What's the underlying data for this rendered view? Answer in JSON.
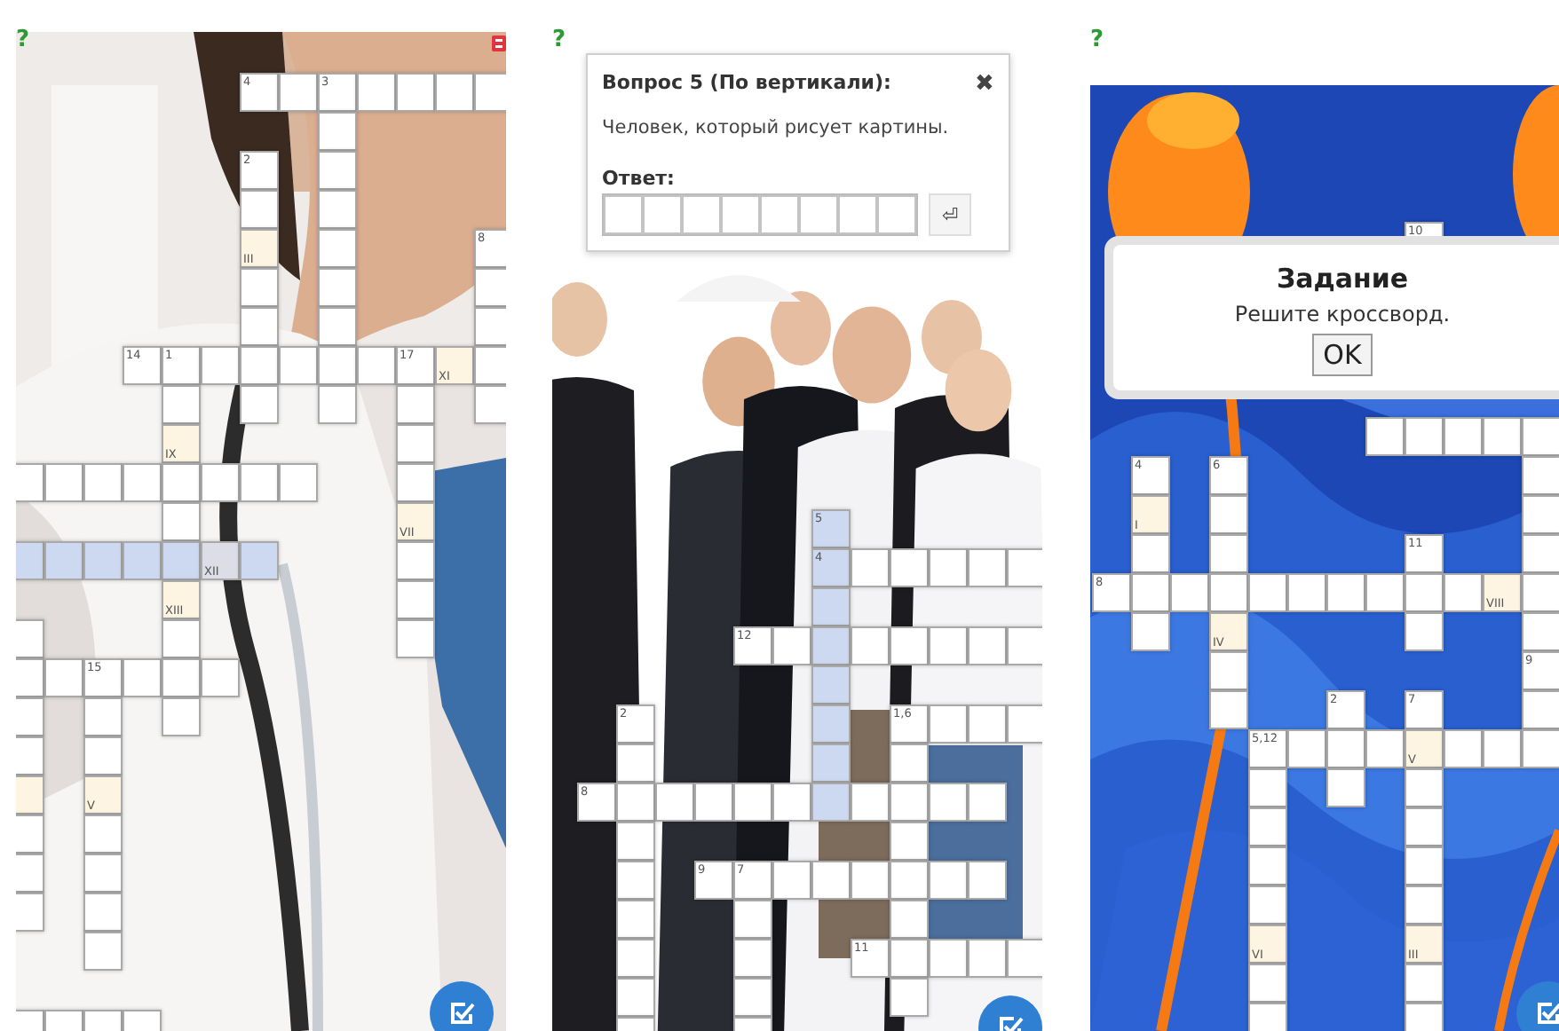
{
  "panels": [
    {
      "help_icon": "?",
      "grid": {
        "rows": [
          [
            {
              "kind": "gap"
            },
            {
              "kind": "gap"
            },
            {
              "kind": "gap"
            },
            {
              "kind": "gap"
            },
            {
              "kind": "gap"
            },
            {
              "kind": "gap"
            },
            {
              "kind": "box",
              "label": "4"
            },
            {
              "kind": "box"
            },
            {
              "kind": "box",
              "label": "3"
            },
            {
              "kind": "box"
            },
            {
              "kind": "box"
            },
            {
              "kind": "box"
            },
            {
              "kind": "box"
            }
          ],
          [
            {
              "kind": "gap"
            },
            {
              "kind": "gap"
            },
            {
              "kind": "gap"
            },
            {
              "kind": "gap"
            },
            {
              "kind": "gap"
            },
            {
              "kind": "gap"
            },
            {
              "kind": "gap"
            },
            {
              "kind": "gap"
            },
            {
              "kind": "box"
            }
          ],
          [
            {
              "kind": "gap"
            },
            {
              "kind": "gap"
            },
            {
              "kind": "gap"
            },
            {
              "kind": "gap"
            },
            {
              "kind": "gap"
            },
            {
              "kind": "gap"
            },
            {
              "kind": "box",
              "label": "2"
            },
            {
              "kind": "gap"
            },
            {
              "kind": "box"
            }
          ],
          [
            {
              "kind": "gap"
            },
            {
              "kind": "gap"
            },
            {
              "kind": "gap"
            },
            {
              "kind": "gap"
            },
            {
              "kind": "gap"
            },
            {
              "kind": "gap"
            },
            {
              "kind": "box"
            },
            {
              "kind": "gap"
            },
            {
              "kind": "box"
            }
          ],
          [
            {
              "kind": "gap"
            },
            {
              "kind": "gap"
            },
            {
              "kind": "gap"
            },
            {
              "kind": "gap"
            },
            {
              "kind": "gap"
            },
            {
              "kind": "gap"
            },
            {
              "kind": "key",
              "label": "III"
            },
            {
              "kind": "gap"
            },
            {
              "kind": "box"
            },
            {
              "kind": "gap"
            },
            {
              "kind": "gap"
            },
            {
              "kind": "gap"
            },
            {
              "kind": "box",
              "label": "8"
            }
          ],
          [
            {
              "kind": "gap"
            },
            {
              "kind": "gap"
            },
            {
              "kind": "gap"
            },
            {
              "kind": "gap"
            },
            {
              "kind": "gap"
            },
            {
              "kind": "gap"
            },
            {
              "kind": "box"
            },
            {
              "kind": "gap"
            },
            {
              "kind": "box"
            },
            {
              "kind": "gap"
            },
            {
              "kind": "gap"
            },
            {
              "kind": "gap"
            },
            {
              "kind": "box"
            }
          ],
          [
            {
              "kind": "gap"
            },
            {
              "kind": "gap"
            },
            {
              "kind": "gap"
            },
            {
              "kind": "gap"
            },
            {
              "kind": "gap"
            },
            {
              "kind": "gap"
            },
            {
              "kind": "box"
            },
            {
              "kind": "gap"
            },
            {
              "kind": "box"
            },
            {
              "kind": "gap"
            },
            {
              "kind": "gap"
            },
            {
              "kind": "gap"
            },
            {
              "kind": "box"
            }
          ],
          [
            {
              "kind": "gap"
            },
            {
              "kind": "gap"
            },
            {
              "kind": "gap"
            },
            {
              "kind": "box",
              "label": "14"
            },
            {
              "kind": "box",
              "label": "1"
            },
            {
              "kind": "box"
            },
            {
              "kind": "box"
            },
            {
              "kind": "box"
            },
            {
              "kind": "box"
            },
            {
              "kind": "box"
            },
            {
              "kind": "box",
              "label": "17"
            },
            {
              "kind": "key",
              "label": "XI"
            },
            {
              "kind": "box"
            }
          ],
          [
            {
              "kind": "gap"
            },
            {
              "kind": "gap"
            },
            {
              "kind": "gap"
            },
            {
              "kind": "gap"
            },
            {
              "kind": "box"
            },
            {
              "kind": "gap"
            },
            {
              "kind": "box"
            },
            {
              "kind": "gap"
            },
            {
              "kind": "box"
            },
            {
              "kind": "gap"
            },
            {
              "kind": "box"
            },
            {
              "kind": "gap"
            },
            {
              "kind": "box"
            }
          ],
          [
            {
              "kind": "gap"
            },
            {
              "kind": "gap"
            },
            {
              "kind": "gap"
            },
            {
              "kind": "gap"
            },
            {
              "kind": "key",
              "label": "IX"
            },
            {
              "kind": "gap"
            },
            {
              "kind": "gap"
            },
            {
              "kind": "gap"
            },
            {
              "kind": "gap"
            },
            {
              "kind": "gap"
            },
            {
              "kind": "box"
            }
          ],
          [
            {
              "kind": "box"
            },
            {
              "kind": "box"
            },
            {
              "kind": "box"
            },
            {
              "kind": "box"
            },
            {
              "kind": "box"
            },
            {
              "kind": "box"
            },
            {
              "kind": "box"
            },
            {
              "kind": "box"
            },
            {
              "kind": "gap"
            },
            {
              "kind": "gap"
            },
            {
              "kind": "box"
            }
          ],
          [
            {
              "kind": "gap"
            },
            {
              "kind": "gap"
            },
            {
              "kind": "gap"
            },
            {
              "kind": "gap"
            },
            {
              "kind": "box"
            },
            {
              "kind": "gap"
            },
            {
              "kind": "gap"
            },
            {
              "kind": "gap"
            },
            {
              "kind": "gap"
            },
            {
              "kind": "gap"
            },
            {
              "kind": "key",
              "label": "VII"
            }
          ],
          [
            {
              "kind": "active"
            },
            {
              "kind": "active"
            },
            {
              "kind": "active"
            },
            {
              "kind": "active"
            },
            {
              "kind": "active"
            },
            {
              "kind": "active_key",
              "label": "XII"
            },
            {
              "kind": "active"
            },
            {
              "kind": "gap"
            },
            {
              "kind": "gap"
            },
            {
              "kind": "gap"
            },
            {
              "kind": "box"
            }
          ],
          [
            {
              "kind": "gap"
            },
            {
              "kind": "gap"
            },
            {
              "kind": "gap"
            },
            {
              "kind": "gap"
            },
            {
              "kind": "key",
              "label": "XIII"
            },
            {
              "kind": "gap"
            },
            {
              "kind": "gap"
            },
            {
              "kind": "gap"
            },
            {
              "kind": "gap"
            },
            {
              "kind": "gap"
            },
            {
              "kind": "box"
            }
          ],
          [
            {
              "kind": "box"
            },
            {
              "kind": "gap"
            },
            {
              "kind": "gap"
            },
            {
              "kind": "gap"
            },
            {
              "kind": "box"
            },
            {
              "kind": "gap"
            },
            {
              "kind": "gap"
            },
            {
              "kind": "gap"
            },
            {
              "kind": "gap"
            },
            {
              "kind": "gap"
            },
            {
              "kind": "box"
            }
          ],
          [
            {
              "kind": "box"
            },
            {
              "kind": "box"
            },
            {
              "kind": "box",
              "label": "15"
            },
            {
              "kind": "box"
            },
            {
              "kind": "box"
            },
            {
              "kind": "box"
            }
          ],
          [
            {
              "kind": "box"
            },
            {
              "kind": "gap"
            },
            {
              "kind": "box"
            },
            {
              "kind": "gap"
            },
            {
              "kind": "box"
            }
          ],
          [
            {
              "kind": "box"
            },
            {
              "kind": "gap"
            },
            {
              "kind": "box"
            }
          ],
          [
            {
              "kind": "key"
            },
            {
              "kind": "gap"
            },
            {
              "kind": "key",
              "label": "V"
            }
          ],
          [
            {
              "kind": "box"
            },
            {
              "kind": "gap"
            },
            {
              "kind": "box"
            }
          ],
          [
            {
              "kind": "box"
            },
            {
              "kind": "gap"
            },
            {
              "kind": "box"
            }
          ],
          [
            {
              "kind": "box"
            },
            {
              "kind": "gap"
            },
            {
              "kind": "box"
            }
          ],
          [
            {
              "kind": "gap"
            },
            {
              "kind": "gap"
            },
            {
              "kind": "box"
            }
          ],
          [
            {
              "kind": "gap"
            }
          ],
          [
            {
              "kind": "box"
            },
            {
              "kind": "box"
            },
            {
              "kind": "box"
            },
            {
              "kind": "box"
            }
          ]
        ]
      }
    },
    {
      "help_icon": "?",
      "grid": {
        "rows": [
          [
            {
              "kind": "gap"
            },
            {
              "kind": "gap"
            },
            {
              "kind": "gap"
            },
            {
              "kind": "gap"
            },
            {
              "kind": "gap"
            },
            {
              "kind": "gap"
            },
            {
              "kind": "active",
              "label": "5"
            }
          ],
          [
            {
              "kind": "gap"
            },
            {
              "kind": "gap"
            },
            {
              "kind": "gap"
            },
            {
              "kind": "gap"
            },
            {
              "kind": "gap"
            },
            {
              "kind": "gap"
            },
            {
              "kind": "active",
              "label": "4"
            },
            {
              "kind": "box"
            },
            {
              "kind": "box"
            },
            {
              "kind": "box"
            },
            {
              "kind": "box"
            },
            {
              "kind": "box"
            }
          ],
          [
            {
              "kind": "gap"
            },
            {
              "kind": "gap"
            },
            {
              "kind": "gap"
            },
            {
              "kind": "gap"
            },
            {
              "kind": "gap"
            },
            {
              "kind": "gap"
            },
            {
              "kind": "active"
            }
          ],
          [
            {
              "kind": "gap"
            },
            {
              "kind": "gap"
            },
            {
              "kind": "gap"
            },
            {
              "kind": "gap"
            },
            {
              "kind": "box",
              "label": "12"
            },
            {
              "kind": "box"
            },
            {
              "kind": "active"
            },
            {
              "kind": "box"
            },
            {
              "kind": "box"
            },
            {
              "kind": "box"
            },
            {
              "kind": "box"
            },
            {
              "kind": "box"
            }
          ],
          [
            {
              "kind": "gap"
            },
            {
              "kind": "gap"
            },
            {
              "kind": "gap"
            },
            {
              "kind": "gap"
            },
            {
              "kind": "gap"
            },
            {
              "kind": "gap"
            },
            {
              "kind": "active"
            }
          ],
          [
            {
              "kind": "gap"
            },
            {
              "kind": "box",
              "label": "2"
            },
            {
              "kind": "gap"
            },
            {
              "kind": "gap"
            },
            {
              "kind": "gap"
            },
            {
              "kind": "gap"
            },
            {
              "kind": "active"
            },
            {
              "kind": "gap"
            },
            {
              "kind": "box",
              "label": "1,6"
            },
            {
              "kind": "box"
            },
            {
              "kind": "box"
            },
            {
              "kind": "box"
            }
          ],
          [
            {
              "kind": "gap"
            },
            {
              "kind": "box"
            },
            {
              "kind": "gap"
            },
            {
              "kind": "gap"
            },
            {
              "kind": "gap"
            },
            {
              "kind": "gap"
            },
            {
              "kind": "active"
            },
            {
              "kind": "gap"
            },
            {
              "kind": "box"
            }
          ],
          [
            {
              "kind": "box",
              "label": "8"
            },
            {
              "kind": "box"
            },
            {
              "kind": "box"
            },
            {
              "kind": "box"
            },
            {
              "kind": "box"
            },
            {
              "kind": "box"
            },
            {
              "kind": "active"
            },
            {
              "kind": "box"
            },
            {
              "kind": "box"
            },
            {
              "kind": "box"
            },
            {
              "kind": "box"
            }
          ],
          [
            {
              "kind": "gap"
            },
            {
              "kind": "box"
            },
            {
              "kind": "gap"
            },
            {
              "kind": "gap"
            },
            {
              "kind": "gap"
            },
            {
              "kind": "gap"
            },
            {
              "kind": "gap"
            },
            {
              "kind": "gap"
            },
            {
              "kind": "box"
            }
          ],
          [
            {
              "kind": "gap"
            },
            {
              "kind": "box"
            },
            {
              "kind": "gap"
            },
            {
              "kind": "box",
              "label": "9"
            },
            {
              "kind": "box",
              "label": "7"
            },
            {
              "kind": "box"
            },
            {
              "kind": "box"
            },
            {
              "kind": "box"
            },
            {
              "kind": "box"
            },
            {
              "kind": "box"
            },
            {
              "kind": "box"
            }
          ],
          [
            {
              "kind": "gap"
            },
            {
              "kind": "box"
            },
            {
              "kind": "gap"
            },
            {
              "kind": "gap"
            },
            {
              "kind": "box"
            },
            {
              "kind": "gap"
            },
            {
              "kind": "gap"
            },
            {
              "kind": "gap"
            },
            {
              "kind": "box"
            }
          ],
          [
            {
              "kind": "gap"
            },
            {
              "kind": "box"
            },
            {
              "kind": "gap"
            },
            {
              "kind": "gap"
            },
            {
              "kind": "box"
            },
            {
              "kind": "gap"
            },
            {
              "kind": "gap"
            },
            {
              "kind": "box",
              "label": "11"
            },
            {
              "kind": "box"
            },
            {
              "kind": "box"
            },
            {
              "kind": "box"
            },
            {
              "kind": "box"
            }
          ],
          [
            {
              "kind": "gap"
            },
            {
              "kind": "box"
            },
            {
              "kind": "gap"
            },
            {
              "kind": "gap"
            },
            {
              "kind": "box"
            },
            {
              "kind": "gap"
            },
            {
              "kind": "gap"
            },
            {
              "kind": "gap"
            },
            {
              "kind": "box"
            }
          ],
          [
            {
              "kind": "gap"
            },
            {
              "kind": "box"
            },
            {
              "kind": "gap"
            },
            {
              "kind": "gap"
            },
            {
              "kind": "box"
            }
          ]
        ]
      },
      "question": {
        "title": "Вопрос 5 (По вертикали):",
        "close": "✖",
        "text": "Человек, который рисует картины.",
        "answer_label": "Ответ:",
        "enter": "⏎"
      }
    },
    {
      "help_icon": "?",
      "grid": {
        "rows": [
          [
            {
              "kind": "gap"
            },
            {
              "kind": "gap"
            },
            {
              "kind": "gap"
            },
            {
              "kind": "gap"
            },
            {
              "kind": "gap"
            },
            {
              "kind": "gap"
            },
            {
              "kind": "gap"
            },
            {
              "kind": "gap"
            },
            {
              "kind": "box",
              "label": "10"
            }
          ],
          [
            {
              "kind": "gap"
            }
          ],
          [
            {
              "kind": "gap"
            }
          ],
          [
            {
              "kind": "gap"
            }
          ],
          [
            {
              "kind": "gap"
            }
          ],
          [
            {
              "kind": "gap"
            },
            {
              "kind": "gap"
            },
            {
              "kind": "gap"
            },
            {
              "kind": "gap"
            },
            {
              "kind": "gap"
            },
            {
              "kind": "gap"
            },
            {
              "kind": "gap"
            },
            {
              "kind": "box"
            },
            {
              "kind": "box"
            },
            {
              "kind": "box"
            },
            {
              "kind": "box"
            },
            {
              "kind": "box"
            }
          ],
          [
            {
              "kind": "gap"
            },
            {
              "kind": "box",
              "label": "4"
            },
            {
              "kind": "gap"
            },
            {
              "kind": "box",
              "label": "6"
            },
            {
              "kind": "gap"
            },
            {
              "kind": "gap"
            },
            {
              "kind": "gap"
            },
            {
              "kind": "gap"
            },
            {
              "kind": "gap"
            },
            {
              "kind": "gap"
            },
            {
              "kind": "gap"
            },
            {
              "kind": "box"
            }
          ],
          [
            {
              "kind": "gap"
            },
            {
              "kind": "key",
              "label": "I"
            },
            {
              "kind": "gap"
            },
            {
              "kind": "box"
            },
            {
              "kind": "gap"
            },
            {
              "kind": "gap"
            },
            {
              "kind": "gap"
            },
            {
              "kind": "gap"
            },
            {
              "kind": "gap"
            },
            {
              "kind": "gap"
            },
            {
              "kind": "gap"
            },
            {
              "kind": "box"
            }
          ],
          [
            {
              "kind": "gap"
            },
            {
              "kind": "box"
            },
            {
              "kind": "gap"
            },
            {
              "kind": "box"
            },
            {
              "kind": "gap"
            },
            {
              "kind": "gap"
            },
            {
              "kind": "gap"
            },
            {
              "kind": "gap"
            },
            {
              "kind": "box",
              "label": "11"
            },
            {
              "kind": "gap"
            },
            {
              "kind": "gap"
            },
            {
              "kind": "box"
            }
          ],
          [
            {
              "kind": "box",
              "label": "8"
            },
            {
              "kind": "box"
            },
            {
              "kind": "box"
            },
            {
              "kind": "box"
            },
            {
              "kind": "box"
            },
            {
              "kind": "box"
            },
            {
              "kind": "box"
            },
            {
              "kind": "box"
            },
            {
              "kind": "box"
            },
            {
              "kind": "box"
            },
            {
              "kind": "key",
              "label": "VIII"
            },
            {
              "kind": "box"
            }
          ],
          [
            {
              "kind": "gap"
            },
            {
              "kind": "box"
            },
            {
              "kind": "gap"
            },
            {
              "kind": "key",
              "label": "IV"
            },
            {
              "kind": "gap"
            },
            {
              "kind": "gap"
            },
            {
              "kind": "gap"
            },
            {
              "kind": "gap"
            },
            {
              "kind": "box"
            },
            {
              "kind": "gap"
            },
            {
              "kind": "gap"
            },
            {
              "kind": "box"
            }
          ],
          [
            {
              "kind": "gap"
            },
            {
              "kind": "gap"
            },
            {
              "kind": "gap"
            },
            {
              "kind": "box"
            },
            {
              "kind": "gap"
            },
            {
              "kind": "gap"
            },
            {
              "kind": "gap"
            },
            {
              "kind": "gap"
            },
            {
              "kind": "gap"
            },
            {
              "kind": "gap"
            },
            {
              "kind": "gap"
            },
            {
              "kind": "box",
              "label": "9"
            }
          ],
          [
            {
              "kind": "gap"
            },
            {
              "kind": "gap"
            },
            {
              "kind": "gap"
            },
            {
              "kind": "box"
            },
            {
              "kind": "gap"
            },
            {
              "kind": "gap"
            },
            {
              "kind": "box",
              "label": "2"
            },
            {
              "kind": "gap"
            },
            {
              "kind": "box",
              "label": "7"
            },
            {
              "kind": "gap"
            },
            {
              "kind": "gap"
            },
            {
              "kind": "box"
            }
          ],
          [
            {
              "kind": "gap"
            },
            {
              "kind": "gap"
            },
            {
              "kind": "gap"
            },
            {
              "kind": "gap"
            },
            {
              "kind": "box",
              "label": "5,12"
            },
            {
              "kind": "box"
            },
            {
              "kind": "box"
            },
            {
              "kind": "box"
            },
            {
              "kind": "key",
              "label": "V"
            },
            {
              "kind": "box"
            },
            {
              "kind": "box"
            },
            {
              "kind": "box"
            }
          ],
          [
            {
              "kind": "gap"
            },
            {
              "kind": "gap"
            },
            {
              "kind": "gap"
            },
            {
              "kind": "gap"
            },
            {
              "kind": "box"
            },
            {
              "kind": "gap"
            },
            {
              "kind": "box"
            },
            {
              "kind": "gap"
            },
            {
              "kind": "box"
            }
          ],
          [
            {
              "kind": "gap"
            },
            {
              "kind": "gap"
            },
            {
              "kind": "gap"
            },
            {
              "kind": "gap"
            },
            {
              "kind": "box"
            },
            {
              "kind": "gap"
            },
            {
              "kind": "gap"
            },
            {
              "kind": "gap"
            },
            {
              "kind": "box"
            }
          ],
          [
            {
              "kind": "gap"
            },
            {
              "kind": "gap"
            },
            {
              "kind": "gap"
            },
            {
              "kind": "gap"
            },
            {
              "kind": "box"
            },
            {
              "kind": "gap"
            },
            {
              "kind": "gap"
            },
            {
              "kind": "gap"
            },
            {
              "kind": "box"
            }
          ],
          [
            {
              "kind": "gap"
            },
            {
              "kind": "gap"
            },
            {
              "kind": "gap"
            },
            {
              "kind": "gap"
            },
            {
              "kind": "box"
            },
            {
              "kind": "gap"
            },
            {
              "kind": "gap"
            },
            {
              "kind": "gap"
            },
            {
              "kind": "box"
            }
          ],
          [
            {
              "kind": "gap"
            },
            {
              "kind": "gap"
            },
            {
              "kind": "gap"
            },
            {
              "kind": "gap"
            },
            {
              "kind": "key",
              "label": "VI"
            },
            {
              "kind": "gap"
            },
            {
              "kind": "gap"
            },
            {
              "kind": "gap"
            },
            {
              "kind": "key",
              "label": "III"
            }
          ],
          [
            {
              "kind": "gap"
            },
            {
              "kind": "gap"
            },
            {
              "kind": "gap"
            },
            {
              "kind": "gap"
            },
            {
              "kind": "box"
            },
            {
              "kind": "gap"
            },
            {
              "kind": "gap"
            },
            {
              "kind": "gap"
            },
            {
              "kind": "box"
            }
          ],
          [
            {
              "kind": "gap"
            },
            {
              "kind": "gap"
            },
            {
              "kind": "gap"
            },
            {
              "kind": "gap"
            },
            {
              "kind": "box"
            },
            {
              "kind": "gap"
            },
            {
              "kind": "gap"
            },
            {
              "kind": "gap"
            },
            {
              "kind": "box"
            }
          ]
        ]
      },
      "task": {
        "title": "Задание",
        "text": "Решите кроссворд.",
        "button": "OK"
      }
    }
  ]
}
